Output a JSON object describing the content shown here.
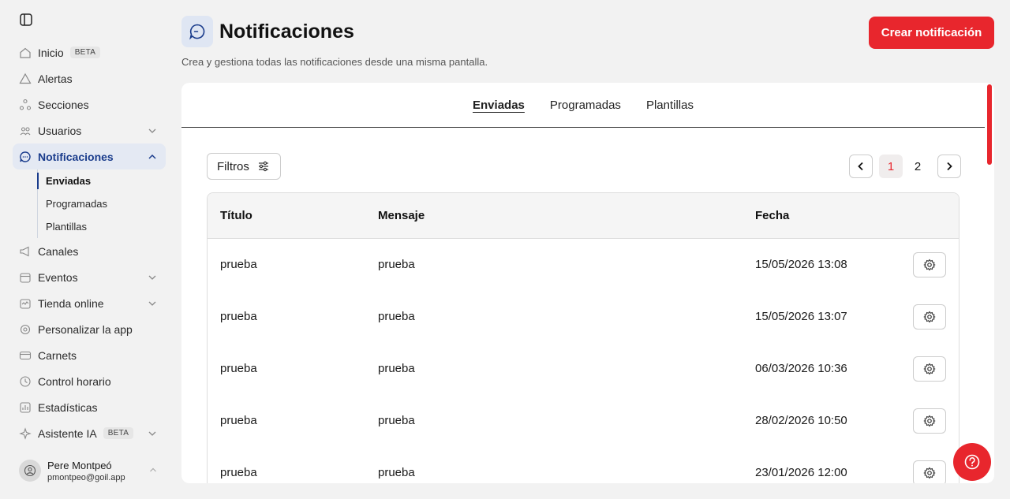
{
  "sidebar": {
    "items": [
      {
        "label": "Inicio",
        "badge": "BETA",
        "icon": "home-icon"
      },
      {
        "label": "Alertas",
        "icon": "alert-triangle-icon"
      },
      {
        "label": "Secciones",
        "icon": "sections-icon"
      },
      {
        "label": "Usuarios",
        "icon": "users-icon"
      },
      {
        "label": "Notificaciones",
        "icon": "chat-bubble-icon"
      },
      {
        "label": "Canales",
        "icon": "megaphone-icon"
      },
      {
        "label": "Eventos",
        "icon": "calendar-icon"
      },
      {
        "label": "Tienda online",
        "icon": "store-icon"
      },
      {
        "label": "Personalizar la app",
        "icon": "customize-icon"
      },
      {
        "label": "Carnets",
        "icon": "card-icon"
      },
      {
        "label": "Control horario",
        "icon": "clock-icon"
      },
      {
        "label": "Estadísticas",
        "icon": "stats-icon"
      },
      {
        "label": "Asistente IA",
        "badge": "BETA",
        "icon": "sparkle-icon"
      }
    ],
    "subitems": [
      {
        "label": "Enviadas"
      },
      {
        "label": "Programadas"
      },
      {
        "label": "Plantillas"
      }
    ],
    "user": {
      "name": "Pere Montpeó",
      "email": "pmontpeo@goil.app"
    }
  },
  "header": {
    "title": "Notificaciones",
    "subtitle": "Crea y gestiona todas las notificaciones desde una misma pantalla.",
    "create_label": "Crear notificación"
  },
  "tabs": [
    "Enviadas",
    "Programadas",
    "Plantillas"
  ],
  "filters_label": "Filtros",
  "pagination": {
    "pages": [
      "1",
      "2"
    ],
    "current": "1"
  },
  "table": {
    "columns": [
      "Título",
      "Mensaje",
      "Fecha"
    ],
    "rows": [
      {
        "title": "prueba",
        "message": "prueba",
        "date": "15/05/2026 13:08"
      },
      {
        "title": "prueba",
        "message": "prueba",
        "date": "15/05/2026 13:07"
      },
      {
        "title": "prueba",
        "message": "prueba",
        "date": "06/03/2026 10:36"
      },
      {
        "title": "prueba",
        "message": "prueba",
        "date": "28/02/2026 10:50"
      },
      {
        "title": "prueba",
        "message": "prueba",
        "date": "23/01/2026 12:00"
      }
    ]
  },
  "colors": {
    "accent": "#e8262d",
    "active_nav": "#1a3c8c",
    "active_nav_bg": "#e4e9f3"
  }
}
